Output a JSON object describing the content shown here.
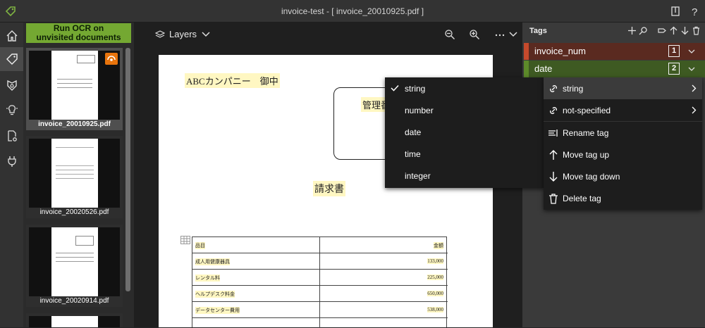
{
  "window": {
    "title": "invoice-test - [ invoice_20010925.pdf ]"
  },
  "nav": {
    "items": [
      {
        "icon": "home-icon"
      },
      {
        "icon": "tag-icon"
      },
      {
        "icon": "model-icon"
      },
      {
        "icon": "lightbulb-icon"
      },
      {
        "icon": "document-settings-icon"
      },
      {
        "icon": "plug-icon"
      }
    ]
  },
  "thumbnails": {
    "ocr_button_line1": "Run OCR on",
    "ocr_button_line2": "unvisited documents",
    "items": [
      {
        "name": "invoice_20010925.pdf"
      },
      {
        "name": "invoice_20020526.pdf"
      },
      {
        "name": "invoice_20020914.pdf"
      }
    ]
  },
  "viewer": {
    "layers_label": "Layers",
    "doc": {
      "company": "ABCカンパニー　御中",
      "box_label": "管理番",
      "heading": "請求書",
      "table_header": [
        "品目",
        "金額"
      ],
      "table_rows": [
        [
          "成人用健康器具",
          "133,000"
        ],
        [
          "レンタル料",
          "225,000"
        ],
        [
          "ヘルプデスク料金",
          "650,000"
        ],
        [
          "データセンター費用",
          "538,000"
        ]
      ]
    }
  },
  "tags": {
    "title": "Tags",
    "items": [
      {
        "label": "invoice_num",
        "number": "1",
        "color": "#c54a2c"
      },
      {
        "label": "date",
        "number": "2",
        "color": "#5d8a2a"
      }
    ]
  },
  "type_menu": {
    "items": [
      "string",
      "number",
      "date",
      "time",
      "integer"
    ],
    "checked": "string"
  },
  "context_menu": {
    "items": [
      {
        "label": "string",
        "icon": "link-icon"
      },
      {
        "label": "not-specified",
        "icon": "link-icon"
      },
      {
        "label": "Rename tag",
        "icon": "rename-icon"
      },
      {
        "label": "Move tag up",
        "icon": "arrow-up-icon"
      },
      {
        "label": "Move tag down",
        "icon": "arrow-down-icon"
      },
      {
        "label": "Delete tag",
        "icon": "trash-icon"
      }
    ]
  }
}
